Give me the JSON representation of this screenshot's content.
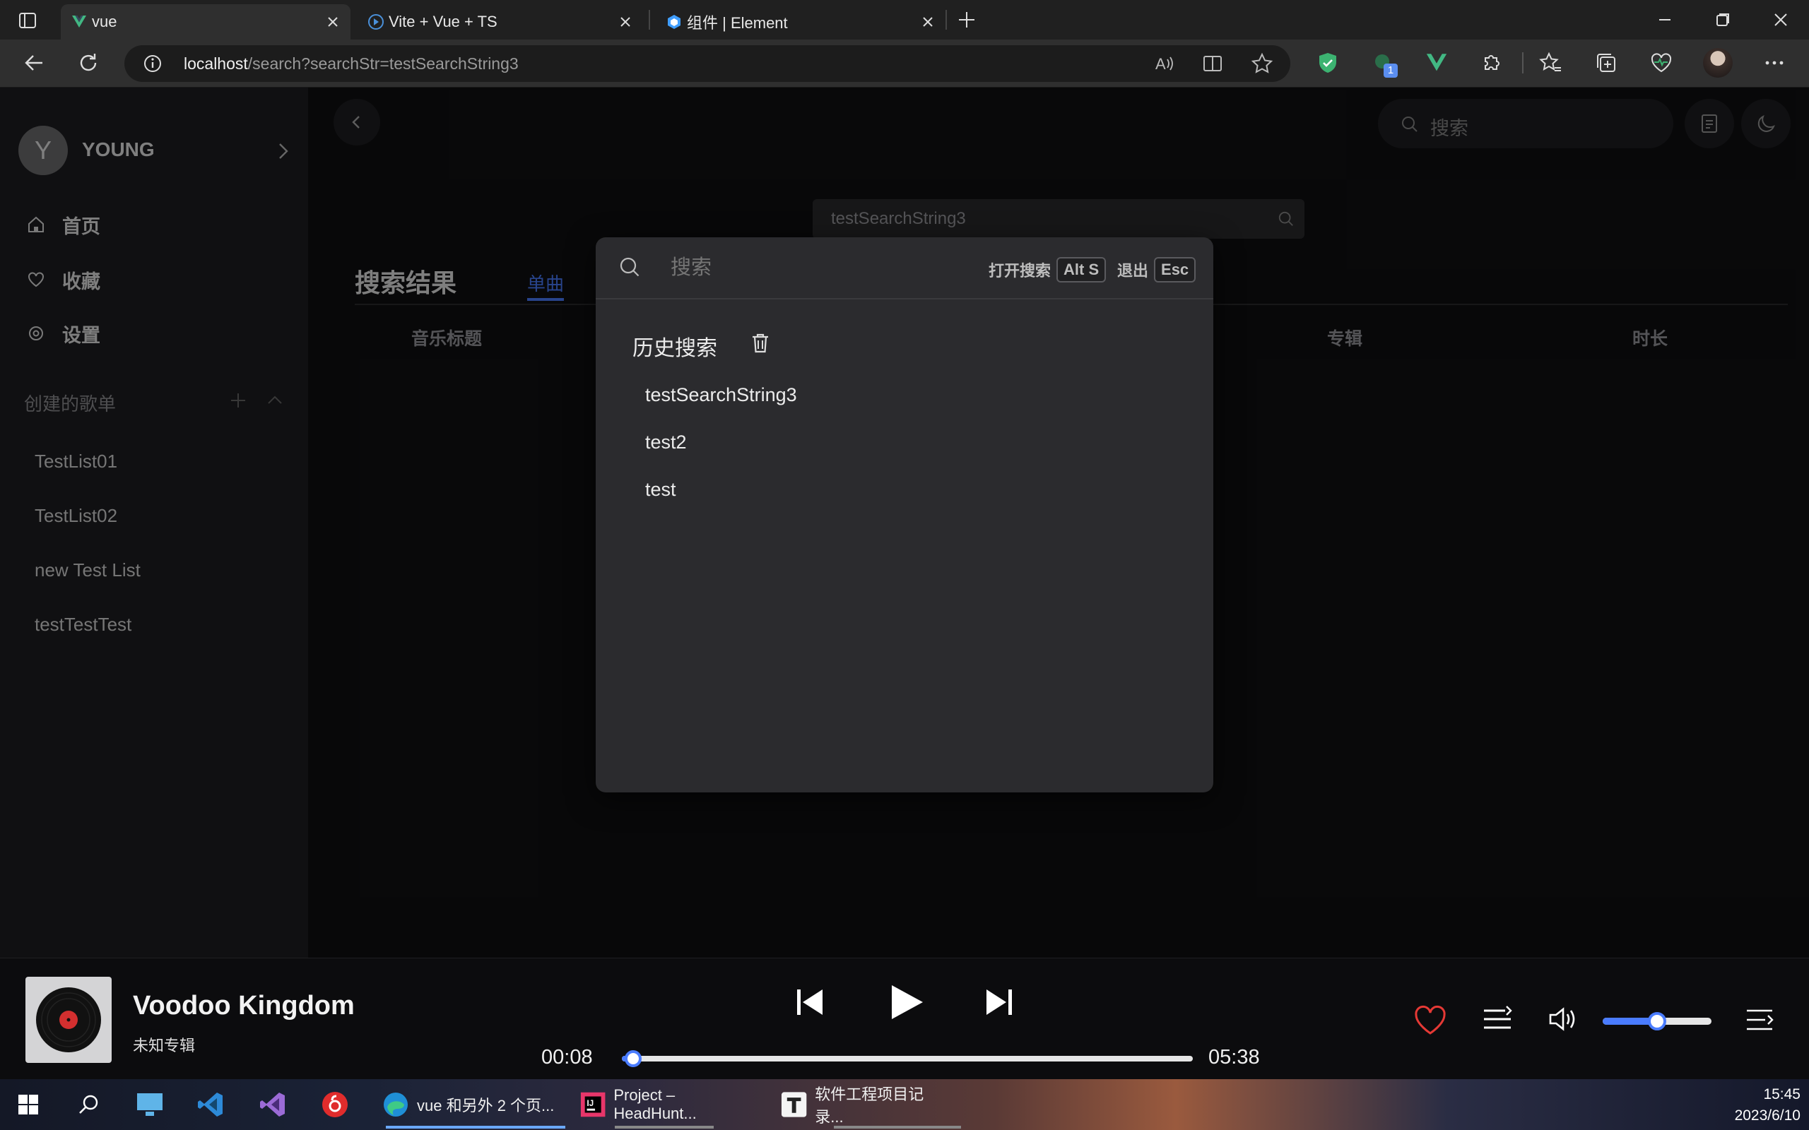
{
  "browser": {
    "tabs": [
      {
        "title": "vue",
        "active": true
      },
      {
        "title": "Vite + Vue + TS",
        "active": false
      },
      {
        "title": "组件 | Element",
        "active": false
      }
    ],
    "url_host": "localhost",
    "url_path": "/search?searchStr=testSearchString3",
    "extension_badge": "1"
  },
  "app": {
    "user": {
      "initial": "Y",
      "name": "YOUNG"
    },
    "nav": [
      {
        "label": "首页",
        "icon": "home-icon"
      },
      {
        "label": "收藏",
        "icon": "heart-icon"
      },
      {
        "label": "设置",
        "icon": "settings-icon"
      }
    ],
    "playlists_header": "创建的歌单",
    "playlists": [
      "TestList01",
      "TestList02",
      "new Test List",
      "testTestTest"
    ],
    "header_search_placeholder": "搜索",
    "search_field_value": "testSearchString3",
    "results_title": "搜索结果",
    "results_tab": "单曲",
    "columns": {
      "title": "音乐标题",
      "album": "专辑",
      "duration": "时长"
    }
  },
  "modal": {
    "placeholder": "搜索",
    "open_label": "打开搜索",
    "open_key": "Alt S",
    "exit_label": "退出",
    "exit_key": "Esc",
    "history_title": "历史搜索",
    "history": [
      "testSearchString3",
      "test2",
      "test"
    ]
  },
  "player": {
    "title": "Voodoo Kingdom",
    "album": "未知专辑",
    "current_time": "00:08",
    "total_time": "05:38",
    "progress": 0.02,
    "volume": 0.5,
    "accent": "#4a7cff",
    "heart_color": "#e53935"
  },
  "taskbar": {
    "apps": [
      "vue 和另外 2 个页...",
      "Project – HeadHunt...",
      "软件工程项目记录..."
    ],
    "time": "15:45",
    "date": "2023/6/10"
  }
}
